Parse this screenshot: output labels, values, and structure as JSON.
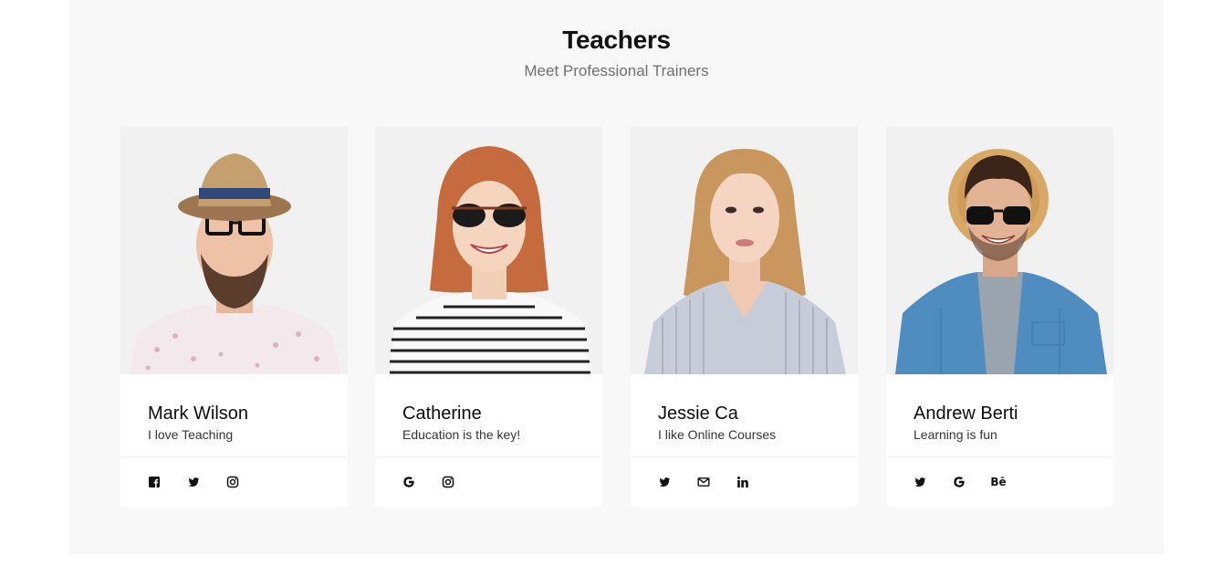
{
  "section": {
    "title": "Teachers",
    "subtitle": "Meet Professional Trainers"
  },
  "teachers": [
    {
      "name": "Mark Wilson",
      "tagline": "I love Teaching",
      "socials": [
        "facebook-icon",
        "twitter-icon",
        "instagram-icon"
      ]
    },
    {
      "name": "Catherine",
      "tagline": "Education is the key!",
      "socials": [
        "google-icon",
        "instagram-icon"
      ]
    },
    {
      "name": "Jessie Ca",
      "tagline": "I like Online Courses",
      "socials": [
        "twitter-icon",
        "mail-icon",
        "linkedin-icon"
      ]
    },
    {
      "name": "Andrew Berti",
      "tagline": "Learning is fun",
      "socials": [
        "twitter-icon",
        "google-icon",
        "behance-icon"
      ],
      "behance_label": "Bē"
    }
  ],
  "colors": {
    "section_bg": "#f7f8f7",
    "card_bg": "#ffffff",
    "photo_bg": "#f0f0f0",
    "title": "#111111",
    "subtitle": "#6f6f6f"
  }
}
